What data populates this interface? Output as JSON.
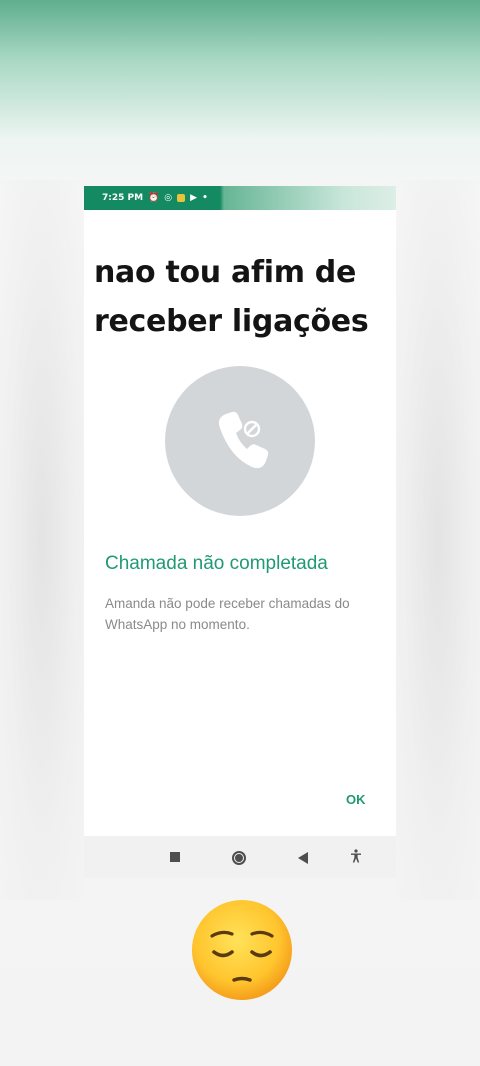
{
  "statusbar": {
    "time": "7:25 PM",
    "icons": [
      "alarm-icon",
      "whatsapp-icon",
      "app-icon",
      "play-icon",
      "dot-icon"
    ]
  },
  "caption": {
    "line1": "nao tou afim de",
    "line2": "receber ligações"
  },
  "dialog": {
    "icon": "call-blocked-icon",
    "title": "Chamada não completada",
    "body": "Amanda não pode receber chamadas do WhatsApp no momento.",
    "ok_label": "OK"
  },
  "navbar": {
    "buttons": [
      "recents-icon",
      "home-icon",
      "back-icon",
      "accessibility-icon"
    ]
  },
  "emoji": "pensive-face",
  "colors": {
    "accent": "#1f9a74",
    "statusbar": "#148a62",
    "circle": "#d3d6d9"
  }
}
